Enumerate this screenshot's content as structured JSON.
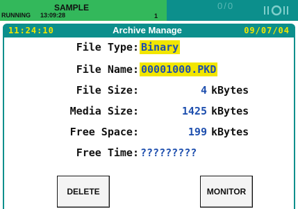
{
  "status": {
    "name": "SAMPLE",
    "state": "RUNNING",
    "time": "13:09:28",
    "count": "1",
    "ghost": "0/0",
    "icon": "signal-bars-icon"
  },
  "titlebar": {
    "time": "11:24:10",
    "title": "Archive Manage",
    "date": "09/07/04"
  },
  "fields": {
    "file_type": {
      "label": "File Type:",
      "value": "Binary"
    },
    "file_name": {
      "label": "File Name:",
      "value": "00001000.PKD"
    },
    "file_size": {
      "label": "File Size:",
      "value": "4",
      "unit": "kBytes"
    },
    "media_size": {
      "label": "Media Size:",
      "value": "1425",
      "unit": "kBytes"
    },
    "free_space": {
      "label": "Free Space:",
      "value": "199",
      "unit": "kBytes"
    },
    "free_time": {
      "label": "Free Time:",
      "value": "?????????"
    }
  },
  "buttons": {
    "delete": "DELETE",
    "monitor": "MONITOR"
  },
  "colors": {
    "status_green": "#33b85b",
    "teal": "#0c8f8c",
    "highlight_yellow": "#f2e600",
    "value_blue": "#1e4fae"
  }
}
